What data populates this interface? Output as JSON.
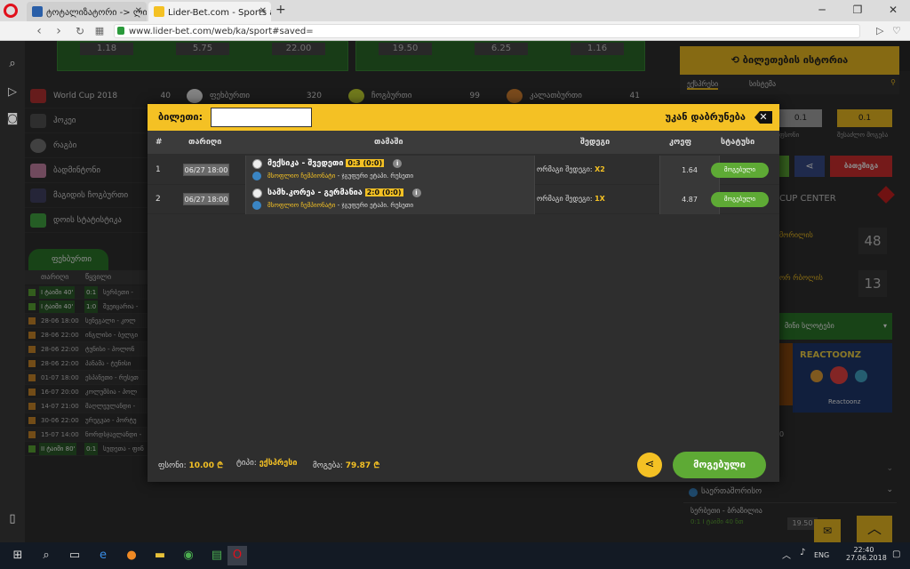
{
  "browser": {
    "tabs": [
      {
        "label": "ტოტალიზატორი -> ლი"
      },
      {
        "label": "Lider-Bet.com - Sports and"
      }
    ],
    "new_tab": "+",
    "url": "www.lider-bet.com/web/ka/sport#saved="
  },
  "background": {
    "top_odds_left": [
      "1.18",
      "5.75",
      "22.00"
    ],
    "top_odds_right": [
      "19.50",
      "6.25",
      "1.16"
    ],
    "sports_menu": [
      {
        "label": "World Cup 2018",
        "count": "40"
      },
      {
        "label": "ჰოკეი"
      },
      {
        "label": "რაგბი"
      },
      {
        "label": "ბადმინტონი"
      },
      {
        "label": "მაგიდის ჩოგბურთი"
      },
      {
        "label": "დოის სტატისტიკა"
      }
    ],
    "sports_menu_right": [
      {
        "label": "ფეხბურთი",
        "count": "320"
      },
      {
        "label": "ჩოგბურთი",
        "count": "99"
      },
      {
        "label": "კალათბურთი",
        "count": "41"
      }
    ],
    "matches_tab": "ფეხბურთი",
    "match_header": [
      "თარიღი",
      "წყვილი"
    ],
    "matches": [
      {
        "time": "I ტაიმი 40'",
        "score": "0:1",
        "team": "სერბეთი -"
      },
      {
        "time": "I ტაიმი 40'",
        "score": "1:0",
        "team": "შვეიცარია -"
      },
      {
        "time": "28-06 18:00",
        "team": "სენეგალი - კოლ"
      },
      {
        "time": "28-06 22:00",
        "team": "ინგლისი - ბელგი"
      },
      {
        "time": "28-06 22:00",
        "team": "ტუნისი - პოლონ"
      },
      {
        "time": "28-06 22:00",
        "team": "პანამა - ტუნისი"
      },
      {
        "time": "01-07 18:00",
        "team": "ესპანეთი - რუსეთ"
      },
      {
        "time": "16-07 20:00",
        "team": "კოლუმბია - პოლ"
      },
      {
        "time": "14-07 21:00",
        "team": "მაღლეულანდი -"
      },
      {
        "time": "30-06 22:00",
        "team": "ურუგვაი - პორტუ"
      },
      {
        "time": "15-07 14:00",
        "team": "ნორდსჯაელანდი -"
      },
      {
        "time": "II ტაიმი 80'",
        "score": "0:1",
        "team": "სუდეთა - ფინ"
      }
    ],
    "right_panel": {
      "history_btn": "ბილეთების ისტორია",
      "tabs": [
        "ექსპრესი",
        "სისტემა"
      ],
      "odd_small_1": "0.1",
      "odd_small_2": "0.1",
      "label_small_1": "ფსონი",
      "label_small_2": "შესაძლო მოგება",
      "bet_btn": "ბათეშიგა",
      "cup_center": "CUP CENTER",
      "player_1": "მორილის",
      "player_1_val": "48",
      "player_2": "ორ რბოლის",
      "player_2_val": "13",
      "slots_title": "მინი სლოტები",
      "game_title": "REACTOONZ",
      "game_caption": "Reactoonz",
      "bottom_section": "საერთაშორისო",
      "bottom_match": "სერბეთი - ბრაზილია",
      "bottom_time": "I ტაიმი 40 ნთ",
      "bottom_score": "0:1",
      "bottom_odd": "19.50",
      "left_num": "0"
    }
  },
  "ticket": {
    "title": "ბილეთი:",
    "ticket_id": "",
    "back_label": "უკან დაბრუნება",
    "columns": {
      "idx": "#",
      "date": "თარიღი",
      "event": "თამაში",
      "pick": "შედეგი",
      "coef": "კოეფ",
      "status": "სტატუსი"
    },
    "rows": [
      {
        "idx": "1",
        "date": "06/27 18:00",
        "teams": "მექსიკა - შვედეთი",
        "score": "0:3 (0:0)",
        "league": "მსოფლიო ჩემპიონატი",
        "league_rest": " - ჯგუფური ეტაპი. რუსეთი",
        "pick_label": "ორმაგი შედეგი: ",
        "pick_value": "X2",
        "coef": "1.64",
        "status": "მოგებული"
      },
      {
        "idx": "2",
        "date": "06/27 18:00",
        "teams": "სამხ.კორეა - გერმანია",
        "score": "2:0 (0:0)",
        "league": "მსოფლიო ჩემპიონატი",
        "league_rest": " - ჯგუფური ეტაპი. რუსეთი",
        "pick_label": "ორმაგი შედეგი: ",
        "pick_value": "1X",
        "coef": "4.87",
        "status": "მოგებული"
      }
    ],
    "footer": {
      "stake_label": "ფსონი:",
      "stake_value": "10.00 ₾",
      "type_label": "ტიპი:",
      "type_value": "ექსპრესი",
      "win_label": "მოგება:",
      "win_value": "79.87 ₾",
      "status_btn": "მოგებული"
    }
  },
  "taskbar": {
    "time": "22:40",
    "date": "27.06.2018",
    "lang": "ENG"
  }
}
